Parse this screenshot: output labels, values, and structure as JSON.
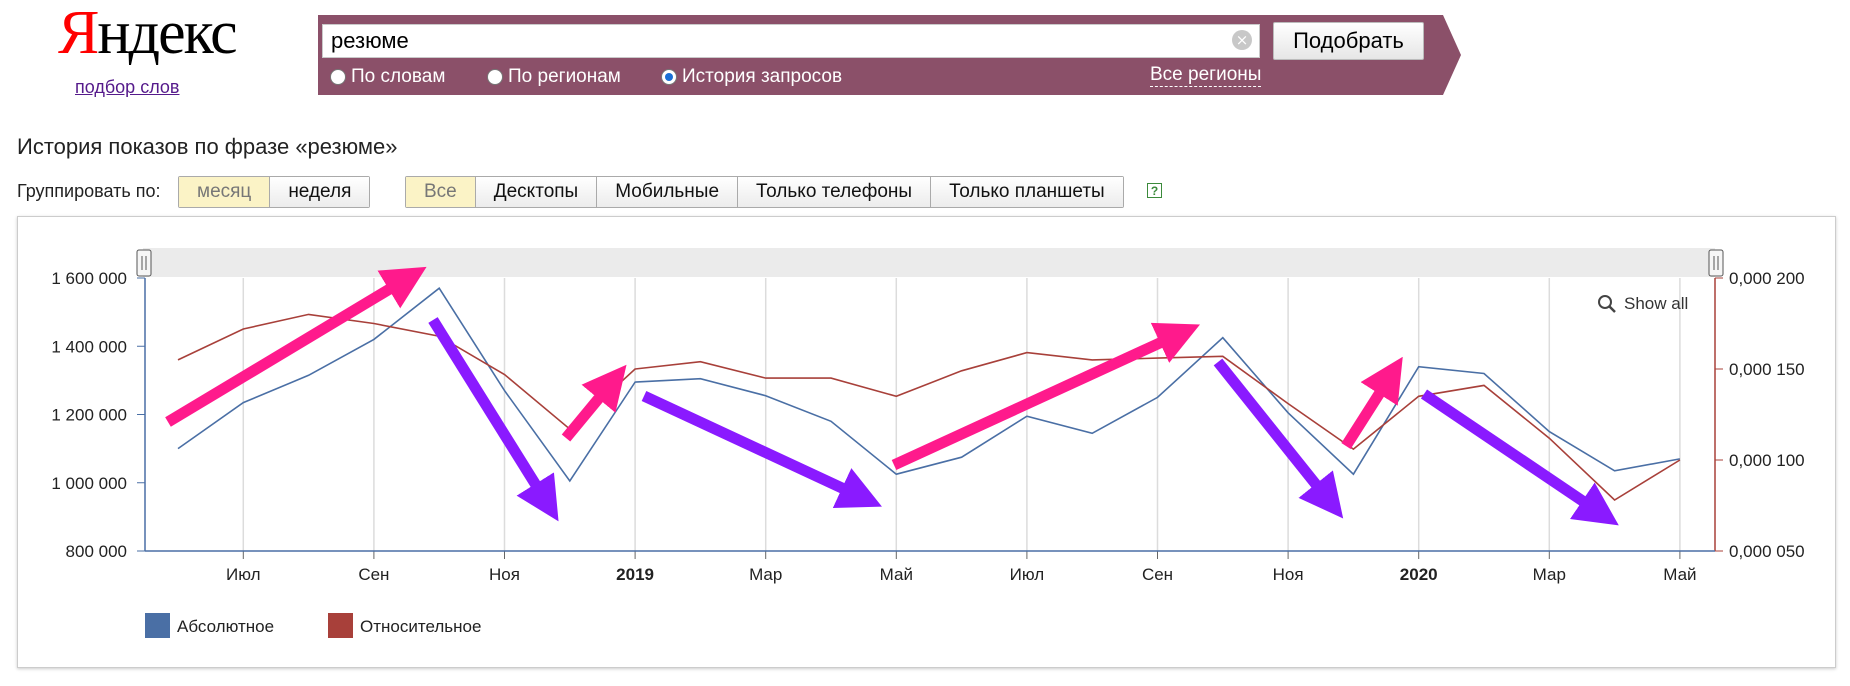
{
  "logo": {
    "first_letter": "Я",
    "rest": "ндекс",
    "subtitle": "подбор слов"
  },
  "search": {
    "query": "резюме",
    "clear_glyph": "×",
    "submit_label": "Подобрать",
    "modes": [
      {
        "label": "По словам",
        "checked": false
      },
      {
        "label": "По регионам",
        "checked": false
      },
      {
        "label": "История запросов",
        "checked": true
      }
    ],
    "regions_link": "Все регионы"
  },
  "heading": "История показов по фразе «резюме»",
  "grouping": {
    "label": "Группировать по:",
    "options": [
      {
        "label": "месяц",
        "active": true
      },
      {
        "label": "неделя",
        "active": false
      }
    ]
  },
  "devices": {
    "options": [
      {
        "label": "Все",
        "active": true
      },
      {
        "label": "Десктопы",
        "active": false
      },
      {
        "label": "Мобильные",
        "active": false
      },
      {
        "label": "Только телефоны",
        "active": false
      },
      {
        "label": "Только планшеты",
        "active": false
      }
    ],
    "help_glyph": "?"
  },
  "chart_data": {
    "type": "line",
    "show_all_label": "Show all",
    "x": [
      "2018-06",
      "2018-07",
      "2018-08",
      "2018-09",
      "2018-10",
      "2018-11",
      "2018-12",
      "2019-01",
      "2019-02",
      "2019-03",
      "2019-04",
      "2019-05",
      "2019-06",
      "2019-07",
      "2019-08",
      "2019-09",
      "2019-10",
      "2019-11",
      "2019-12",
      "2020-01",
      "2020-02",
      "2020-03",
      "2020-04",
      "2020-05"
    ],
    "x_tick_labels": [
      "Июл",
      "Сен",
      "Ноя",
      "2019",
      "Мар",
      "Май",
      "Июл",
      "Сен",
      "Ноя",
      "2020",
      "Мар",
      "Май"
    ],
    "y_left": {
      "ticks": [
        "800 000",
        "1 000 000",
        "1 200 000",
        "1 400 000",
        "1 600 000"
      ],
      "range": [
        800000,
        1600000
      ]
    },
    "y_right": {
      "ticks": [
        "0,000 050",
        "0,000 100",
        "0,000 150",
        "0,000 200"
      ],
      "range": [
        5e-05,
        0.0002
      ]
    },
    "series": [
      {
        "name": "Абсолютное",
        "axis": "left",
        "color": "#4a6fa5",
        "values": [
          1100000,
          1235000,
          1315000,
          1420000,
          1570000,
          1270000,
          1005000,
          1295000,
          1305000,
          1255000,
          1180000,
          1025000,
          1075000,
          1195000,
          1145000,
          1250000,
          1425000,
          1205000,
          1025000,
          1340000,
          1320000,
          1150000,
          1035000,
          1070000
        ]
      },
      {
        "name": "Относительное",
        "axis": "right",
        "color": "#a8403a",
        "values": [
          0.000155,
          0.000172,
          0.00018,
          0.000175,
          0.000168,
          0.000147,
          0.000117,
          0.00015,
          0.000154,
          0.000145,
          0.000145,
          0.000135,
          0.000149,
          0.000159,
          0.000155,
          0.000156,
          0.000157,
          0.000131,
          0.000106,
          0.000135,
          0.000141,
          0.000112,
          7.8e-05,
          0.0001
        ]
      }
    ],
    "legend_position": "bottom-left",
    "grid": true
  }
}
